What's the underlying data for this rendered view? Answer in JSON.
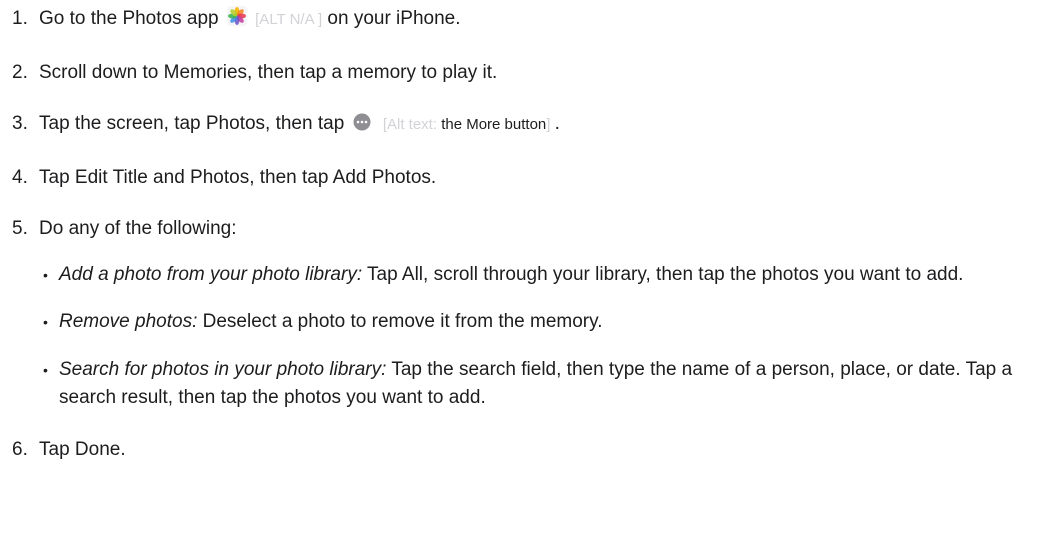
{
  "steps": [
    {
      "num": "1.",
      "pre": "Go to the Photos app",
      "alt": "[ALT N/A ]",
      "post": "on your iPhone.",
      "icon": "photos-app-icon"
    },
    {
      "num": "2.",
      "text": "Scroll down to Memories, then tap a memory to play it."
    },
    {
      "num": "3.",
      "pre": "Tap the screen, tap Photos, then tap",
      "alt_prefix": "[Alt text:",
      "alt_strong": "the More button",
      "alt_suffix": "]",
      "post": ".",
      "icon": "more-button-icon"
    },
    {
      "num": "4.",
      "text": "Tap Edit Title and Photos, then tap Add Photos."
    },
    {
      "num": "5.",
      "text": "Do any of the following:",
      "options": [
        {
          "lead": "Add a photo from your photo library:",
          "text": "Tap All, scroll through your library, then tap the photos you want to add."
        },
        {
          "lead": "Remove photos:",
          "text": "Deselect a photo to remove it from the memory."
        },
        {
          "lead": "Search for photos in your photo library:",
          "text": "Tap the search field, then type the name of a person, place, or date. Tap a search result, then tap the photos you want to add."
        }
      ]
    },
    {
      "num": "6.",
      "text": "Tap Done."
    }
  ]
}
